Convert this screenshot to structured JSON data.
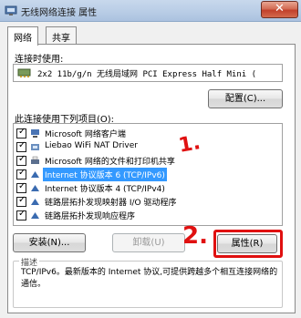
{
  "window": {
    "title": "无线网络连接 属性",
    "close_glyph": "✕"
  },
  "tabs": [
    {
      "label": "网络",
      "active": true
    },
    {
      "label": "共享",
      "active": false
    }
  ],
  "connect_using": {
    "label": "连接时使用:",
    "adapter": "2x2 11b/g/n 无线局域网 PCI Express Half Mini (",
    "configure_button": "配置(C)..."
  },
  "items_section": {
    "label": "此连接使用下列项目(O):",
    "items": [
      {
        "label": "Microsoft 网络客户端",
        "checked": true,
        "icon": "network-client-icon",
        "selected": false
      },
      {
        "label": "Liebao WiFi NAT Driver",
        "checked": true,
        "icon": "driver-icon",
        "selected": false
      },
      {
        "label": "Microsoft 网络的文件和打印机共享",
        "checked": true,
        "icon": "printer-share-icon",
        "selected": false
      },
      {
        "label": "Internet 协议版本 6 (TCP/IPv6)",
        "checked": true,
        "icon": "protocol-icon",
        "selected": true
      },
      {
        "label": "Internet 协议版本 4 (TCP/IPv4)",
        "checked": true,
        "icon": "protocol-icon",
        "selected": false
      },
      {
        "label": "链路层拓扑发现映射器 I/O 驱动程序",
        "checked": true,
        "icon": "protocol-icon",
        "selected": false
      },
      {
        "label": "链路层拓扑发现响应程序",
        "checked": true,
        "icon": "protocol-icon",
        "selected": false
      }
    ]
  },
  "buttons": {
    "install": "安装(N)...",
    "uninstall": "卸载(U)",
    "properties": "属性(R)"
  },
  "description": {
    "title": "描述",
    "text": "TCP/IPv6。最新版本的 Internet 协议,可提供跨越多个相互连接网络的通信。"
  },
  "annotations": {
    "step1": "1.",
    "step2": "2.",
    "color": "#e01010"
  }
}
